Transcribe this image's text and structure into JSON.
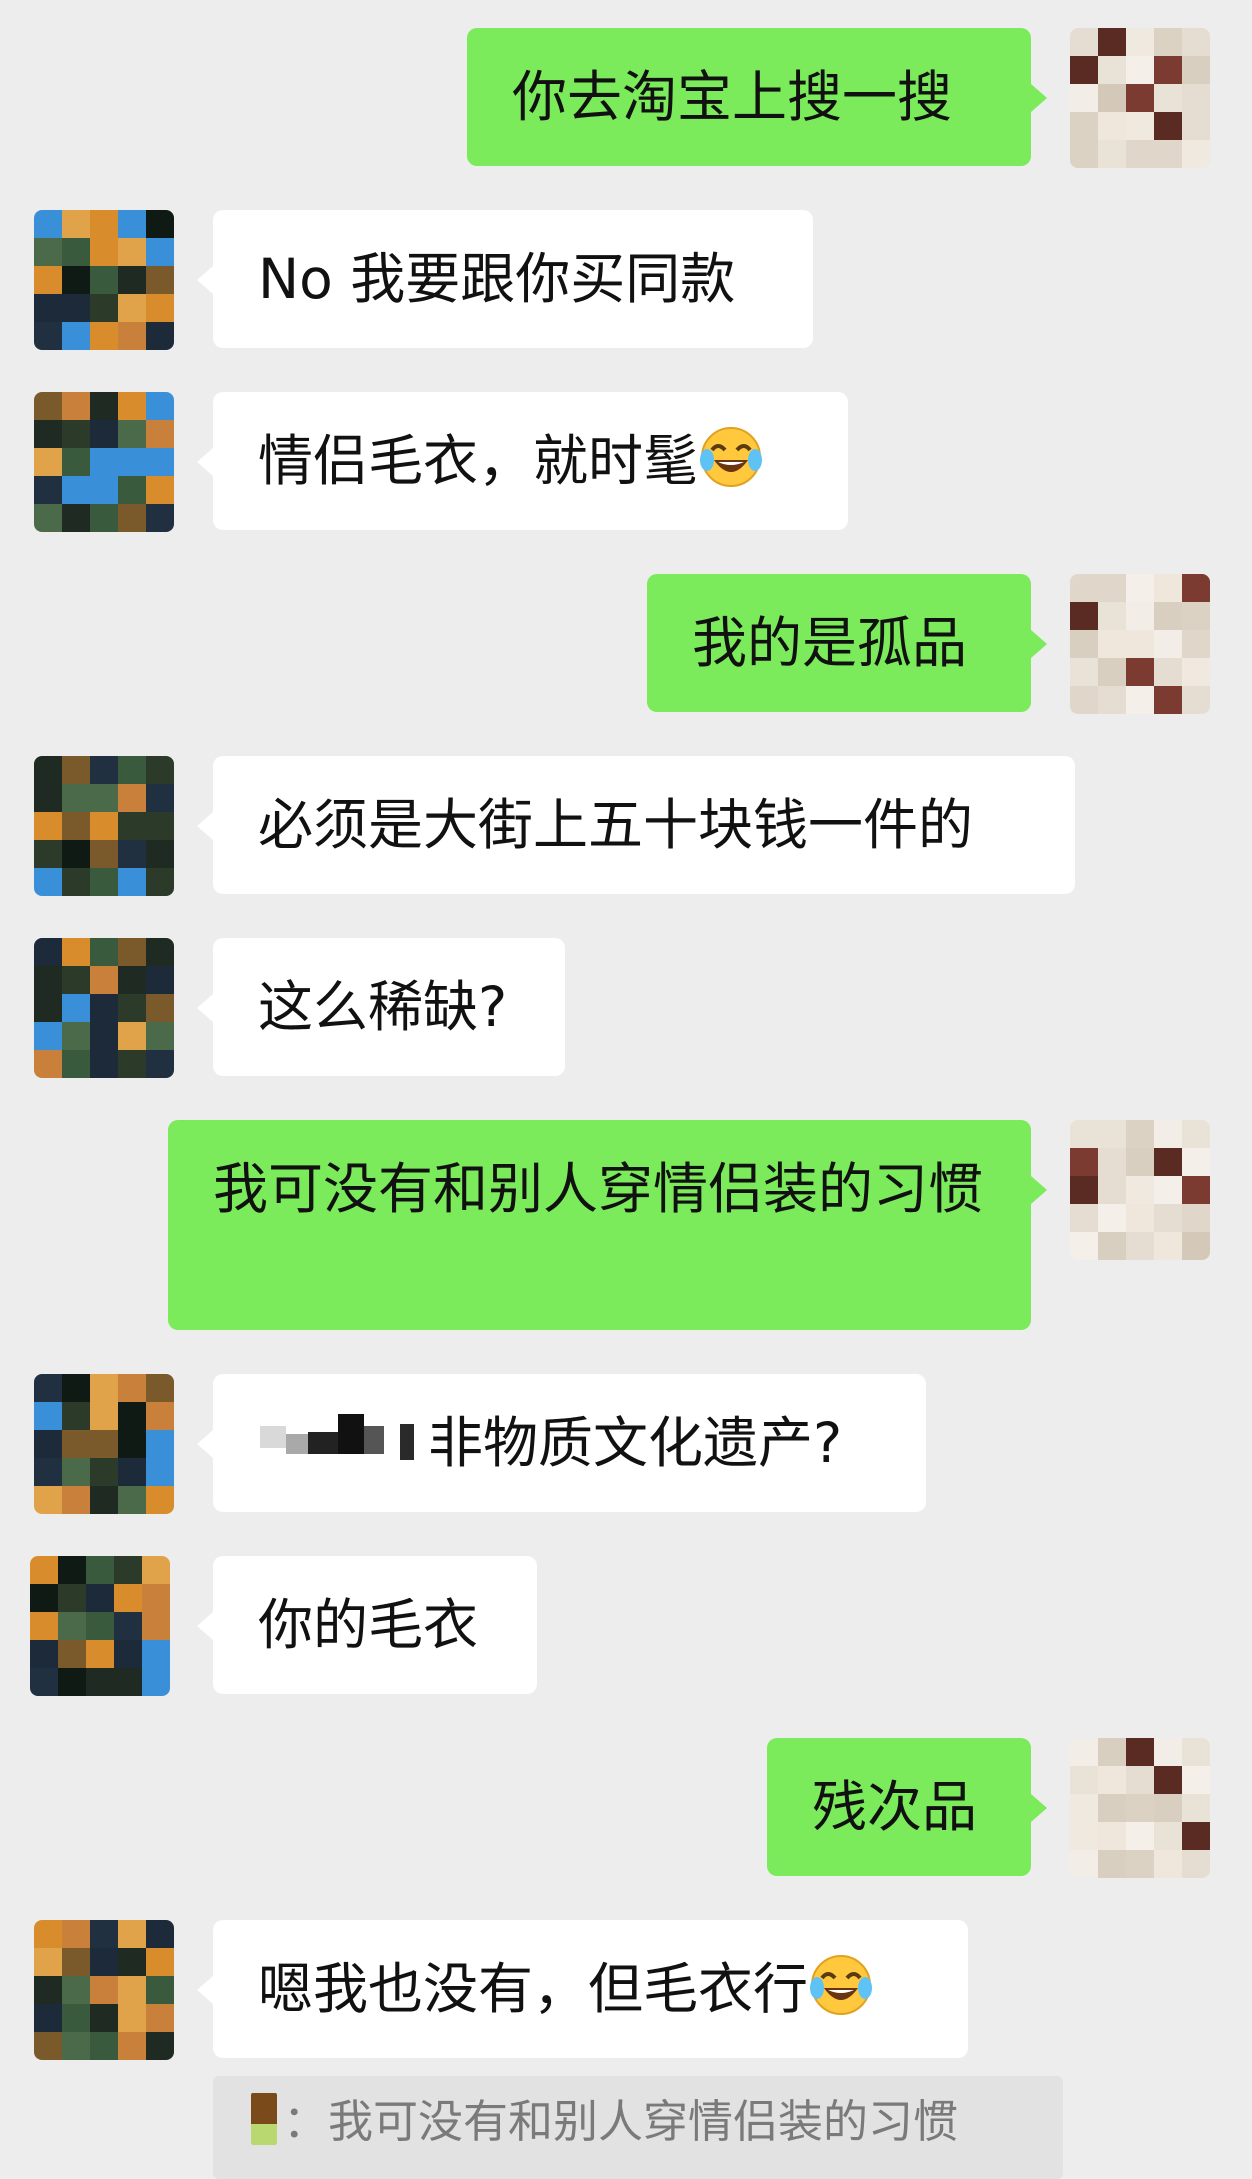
{
  "messages": [
    {
      "side": "sent",
      "text": "你去淘宝上搜一搜"
    },
    {
      "side": "recv",
      "text": "No 我要跟你买同款"
    },
    {
      "side": "recv",
      "text": "情侣毛衣，就时髦",
      "emoji": "face-with-tears-of-joy"
    },
    {
      "side": "sent",
      "text": "我的是孤品"
    },
    {
      "side": "recv",
      "text": "必须是大街上五十块钱一件的"
    },
    {
      "side": "recv",
      "text": "这么稀缺?"
    },
    {
      "side": "sent",
      "text": "我可没有和别人穿情侣装的习惯"
    },
    {
      "side": "recv",
      "text": "非物质文化遗产?",
      "redacted_prefix": true
    },
    {
      "side": "recv",
      "text": "你的毛衣"
    },
    {
      "side": "sent",
      "text": "残次品"
    },
    {
      "side": "recv",
      "text": "嗯我也没有，但毛衣行",
      "emoji": "face-with-tears-of-joy"
    }
  ],
  "quote": {
    "separator": "：",
    "text": "我可没有和别人穿情侣装的习惯"
  },
  "colors": {
    "background": "#ededed",
    "sent_bubble": "#7bea5b",
    "received_bubble": "#ffffff",
    "quote_bubble": "#e2e2e2"
  }
}
